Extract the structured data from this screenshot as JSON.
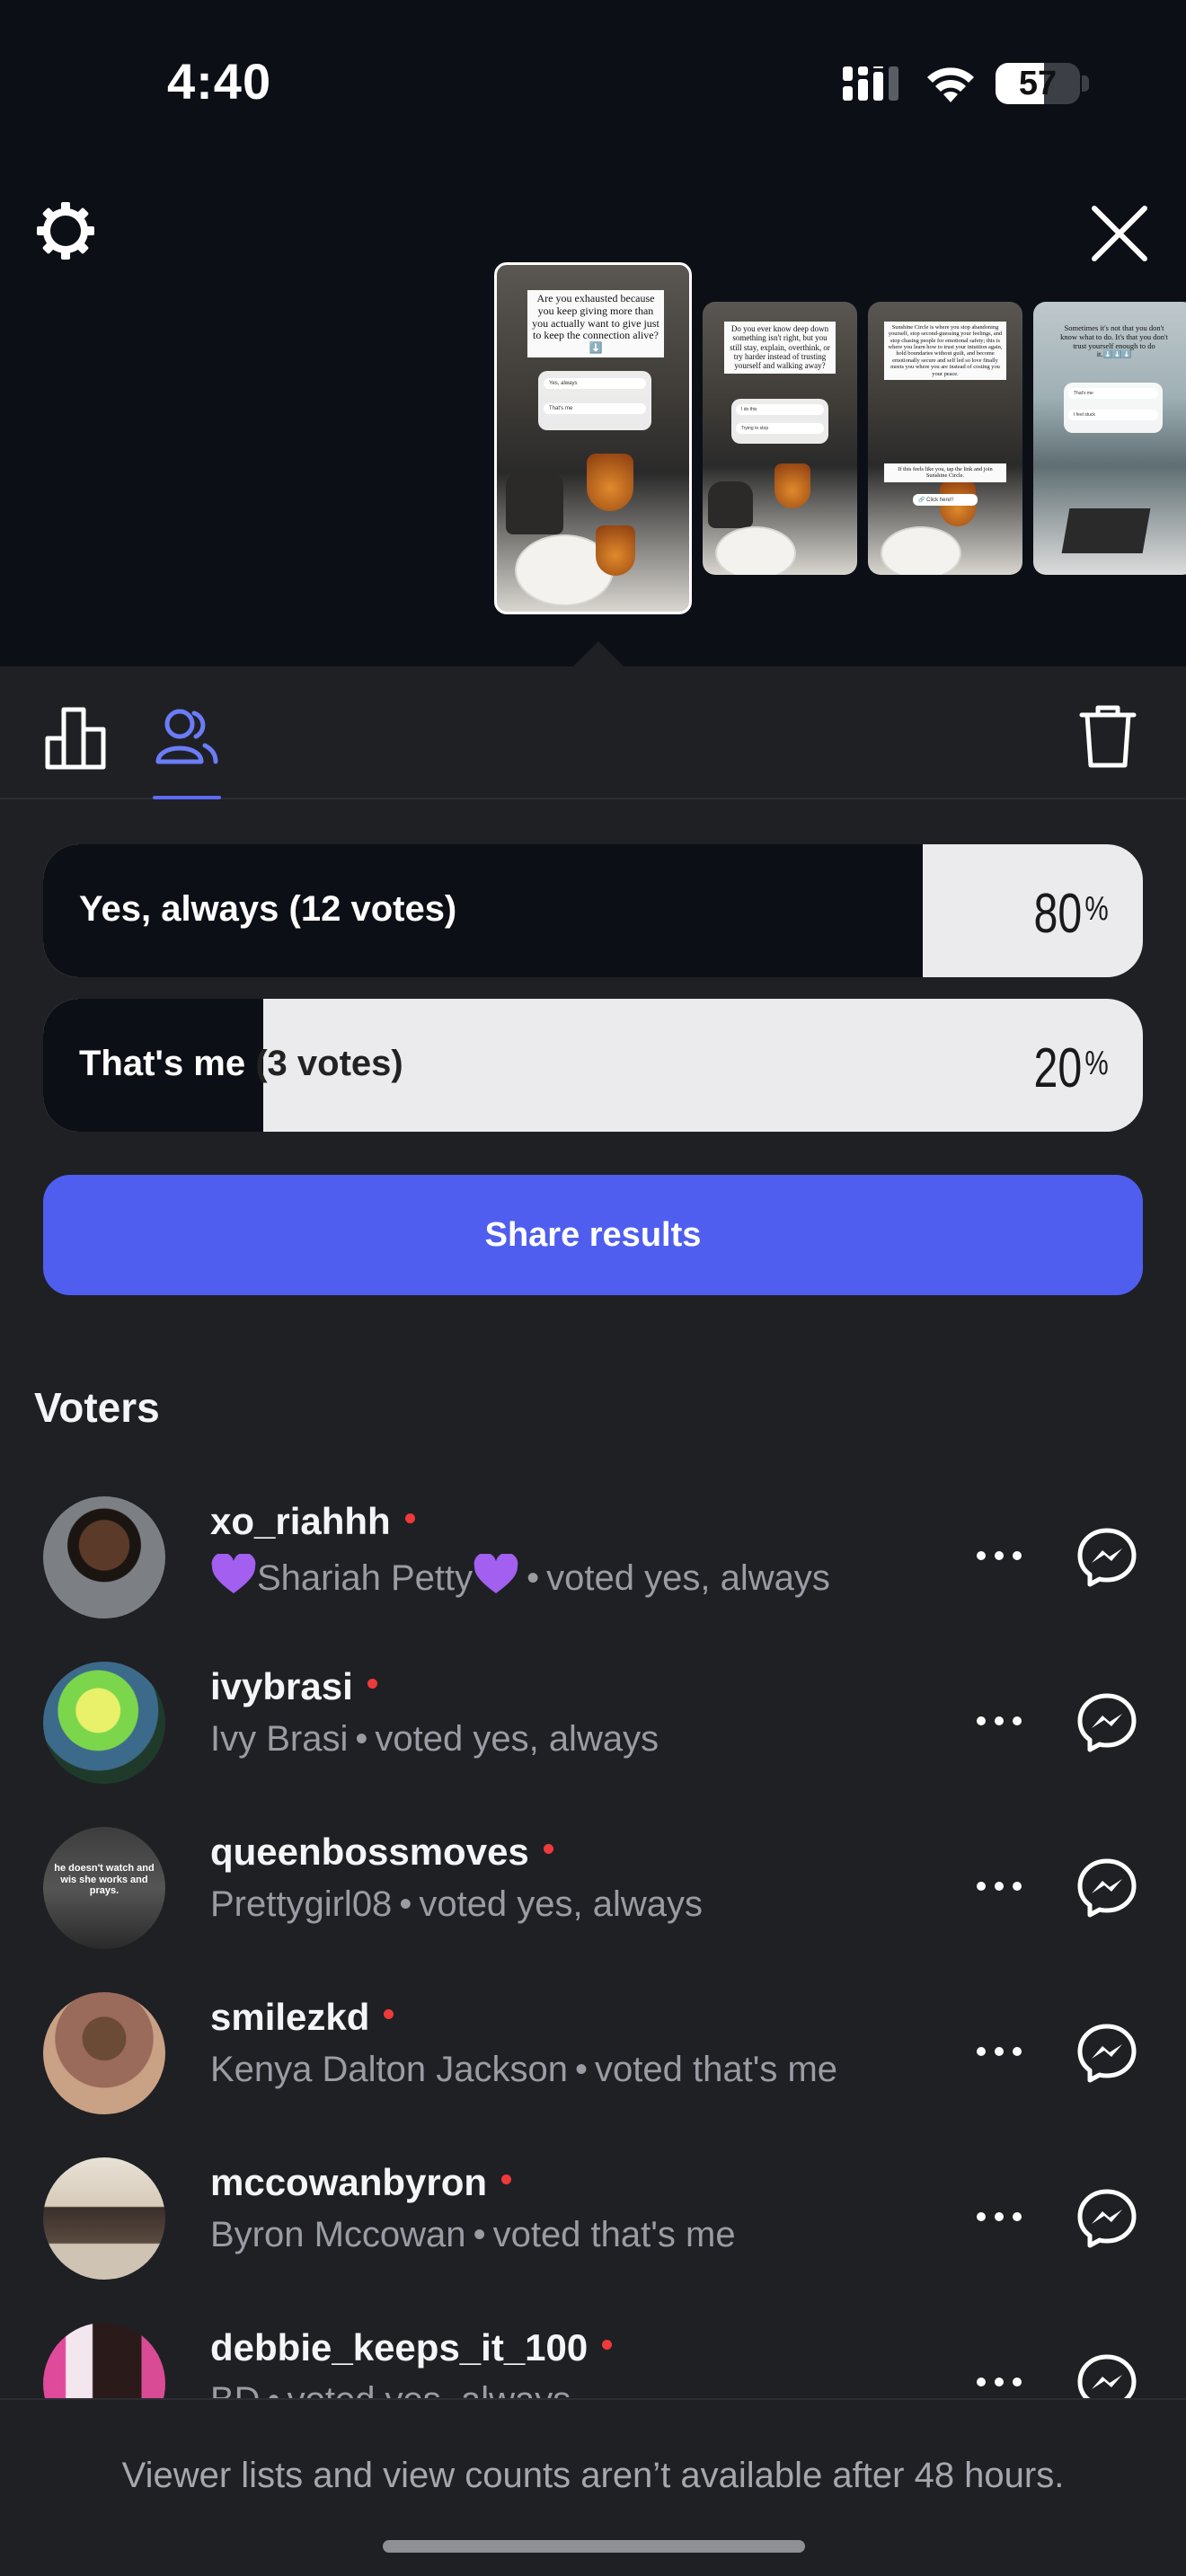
{
  "status_bar": {
    "time": "4:40",
    "battery_level": 57
  },
  "header": {
    "settings_icon": "gear-icon",
    "close_icon": "close-icon"
  },
  "stories": [
    {
      "card_text": "Are you exhausted because you keep giving more than you actually want to give just to keep the connection alive?⬇️",
      "options": [
        "Yes, always",
        "That's me"
      ]
    },
    {
      "card_text": "Do you ever know deep down something isn't right, but you still stay, explain, overthink, or try harder instead of trusting yourself and walking away?",
      "options": [
        "I do this",
        "Trying to stop"
      ]
    },
    {
      "card_text": "Sunshine Circle is where you stop abandoning yourself, stop second-guessing your feelings, and stop chasing people for emotional safety; this is where you learn how to trust your intuition again, hold boundaries without guilt, and become emotionally secure and self led so love finally meets you where you are instead of costing you your peace.",
      "footer_text": "If this feels like you, tap the link and join Sunshine Circle.",
      "link": "🔗 Click here!!"
    },
    {
      "card_text": "Sometimes it's not that you don't know what to do. It's that you don't trust yourself enough to do it.⬇️⬇️⬇️",
      "options": [
        "That's me",
        "I feel stuck"
      ]
    }
  ],
  "tabs": {
    "results_icon": "bar-chart-icon",
    "voters_icon": "people-icon",
    "delete_icon": "trash-icon"
  },
  "poll": {
    "options": [
      {
        "label_start": "Yes, always (12 votes)",
        "label_end": "",
        "percent": 80,
        "pct_text": "80"
      },
      {
        "label_start": "That's me",
        "label_end": " (3 votes)",
        "percent": 20,
        "pct_text": "20"
      }
    ],
    "percent_sign": "%",
    "share_label": "Share results"
  },
  "voters_title": "Voters",
  "voters": [
    {
      "username": "xo_riahhh",
      "name": "Shariah Petty",
      "heart_emoji": true,
      "vote": "voted yes, always"
    },
    {
      "username": "ivybrasi",
      "name": "Ivy Brasi",
      "vote": "voted yes, always"
    },
    {
      "username": "queenbossmoves",
      "name": "Prettygirl08",
      "vote": "voted yes, always",
      "avatar_text": "he doesn't watch and wis she works and prays."
    },
    {
      "username": "smilezkd",
      "name": "Kenya Dalton Jackson",
      "vote": "voted that's me"
    },
    {
      "username": "mccowanbyron",
      "name": "Byron Mccowan",
      "vote": "voted that's me"
    },
    {
      "username": "debbie_keeps_it_100",
      "name": "BD",
      "vote": "voted yes, always"
    }
  ],
  "separator": "•",
  "footer_note": "Viewer lists and view counts aren’t available after 48 hours.",
  "colors": {
    "accent": "#4f5eef",
    "online_dot": "#ef3a3a",
    "sheet_bg": "#1f2024",
    "page_bg": "#0c1016"
  }
}
